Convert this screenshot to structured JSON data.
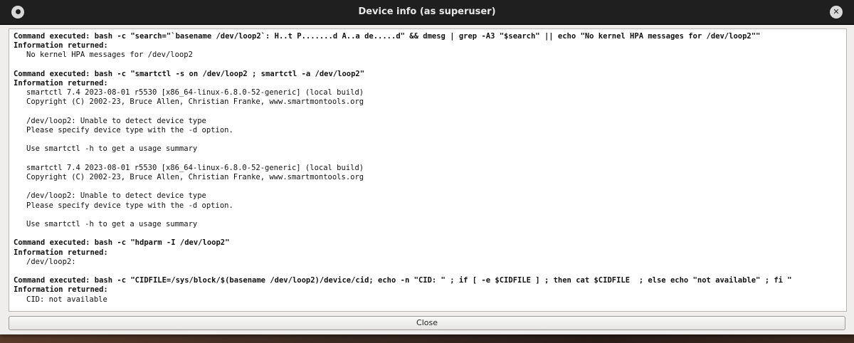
{
  "window": {
    "title": "Device info (as superuser)",
    "close_button": "Close"
  },
  "entries": [
    {
      "command": "Command executed: bash -c \"search=\"`basename /dev/loop2`: H..t P.......d A..a de.....d\" && dmesg | grep -A3 \"$search\" || echo \"No kernel HPA messages for /dev/loop2\"\"",
      "info_label": "Information returned:",
      "output": "No kernel HPA messages for /dev/loop2"
    },
    {
      "command": "Command executed: bash -c \"smartctl -s on /dev/loop2 ; smartctl -a /dev/loop2\"",
      "info_label": "Information returned:",
      "output": "smartctl 7.4 2023-08-01 r5530 [x86_64-linux-6.8.0-52-generic] (local build)\nCopyright (C) 2002-23, Bruce Allen, Christian Franke, www.smartmontools.org\n\n/dev/loop2: Unable to detect device type\nPlease specify device type with the -d option.\n\nUse smartctl -h to get a usage summary\n\nsmartctl 7.4 2023-08-01 r5530 [x86_64-linux-6.8.0-52-generic] (local build)\nCopyright (C) 2002-23, Bruce Allen, Christian Franke, www.smartmontools.org\n\n/dev/loop2: Unable to detect device type\nPlease specify device type with the -d option.\n\nUse smartctl -h to get a usage summary"
    },
    {
      "command": "Command executed: bash -c \"hdparm -I /dev/loop2\"",
      "info_label": "Information returned:",
      "output": "/dev/loop2:"
    },
    {
      "command": "Command executed: bash -c \"CIDFILE=/sys/block/$(basename /dev/loop2)/device/cid; echo -n \"CID: \" ; if [ -e $CIDFILE ] ; then cat $CIDFILE  ; else echo \"not available\" ; fi \"",
      "info_label": "Information returned:",
      "output": "CID: not available"
    }
  ]
}
